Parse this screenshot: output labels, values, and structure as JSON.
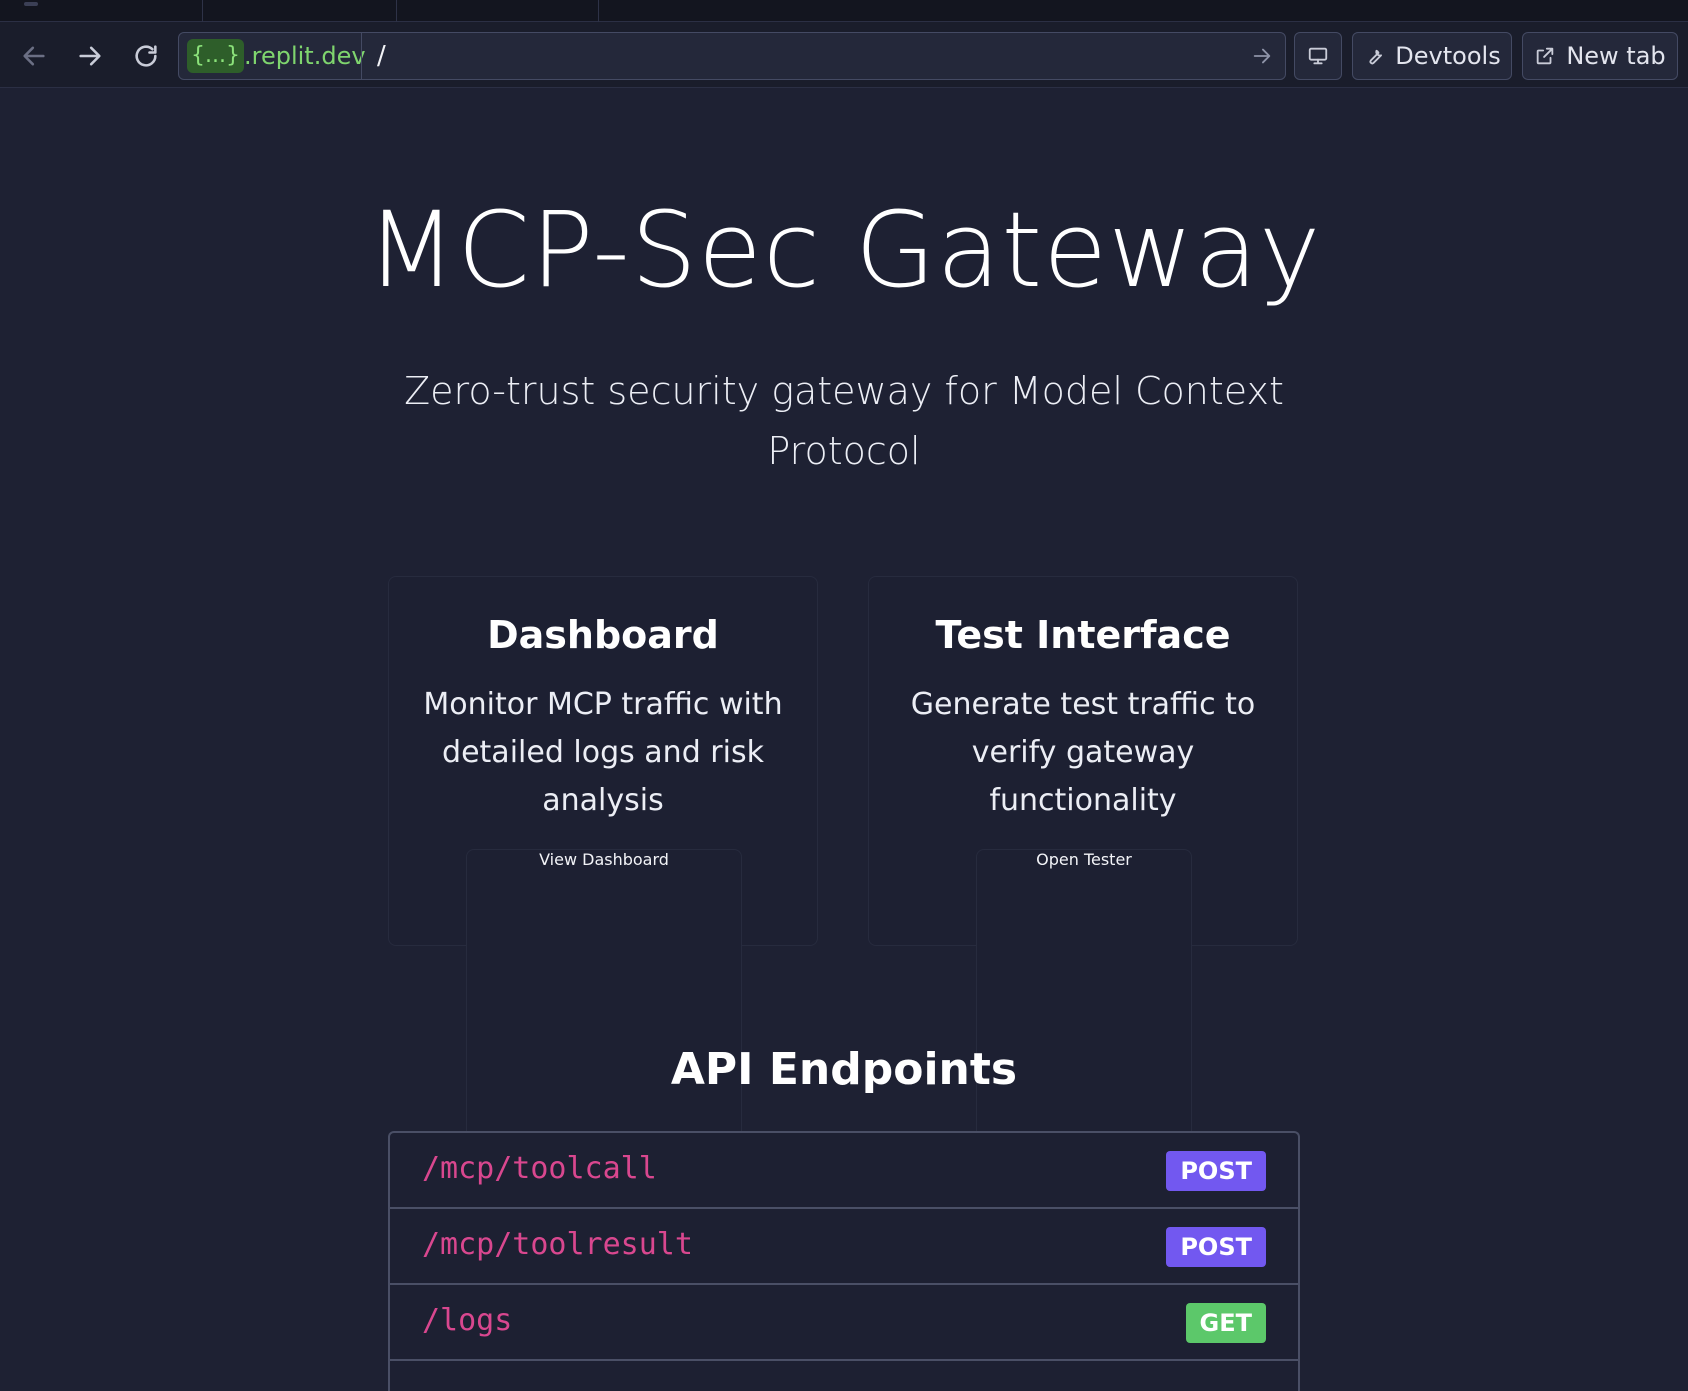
{
  "browser": {
    "url_host_badge": "{...}",
    "url_host_suffix": ".replit.dev",
    "url_path": "/",
    "devtools_label": "Devtools",
    "newtab_label": "New tab"
  },
  "hero": {
    "title": "MCP-Sec Gateway",
    "subtitle": "Zero-trust security gateway for Model Context Protocol"
  },
  "cards": [
    {
      "title": "Dashboard",
      "description": "Monitor MCP traffic with detailed logs and risk analysis",
      "button_label": "View Dashboard"
    },
    {
      "title": "Test Interface",
      "description": "Generate test traffic to verify gateway functionality",
      "button_label": "Open Tester"
    }
  ],
  "api": {
    "title": "API Endpoints",
    "endpoints": [
      {
        "path": "/mcp/toolcall",
        "method": "POST",
        "method_color": "#7258f0"
      },
      {
        "path": "/mcp/toolresult",
        "method": "POST",
        "method_color": "#7258f0"
      },
      {
        "path": "/logs",
        "method": "GET",
        "method_color": "#5cc86a"
      }
    ]
  },
  "colors": {
    "background": "#1e2133",
    "accent": "#6a5ae0",
    "endpoint_path": "#d9478f"
  }
}
